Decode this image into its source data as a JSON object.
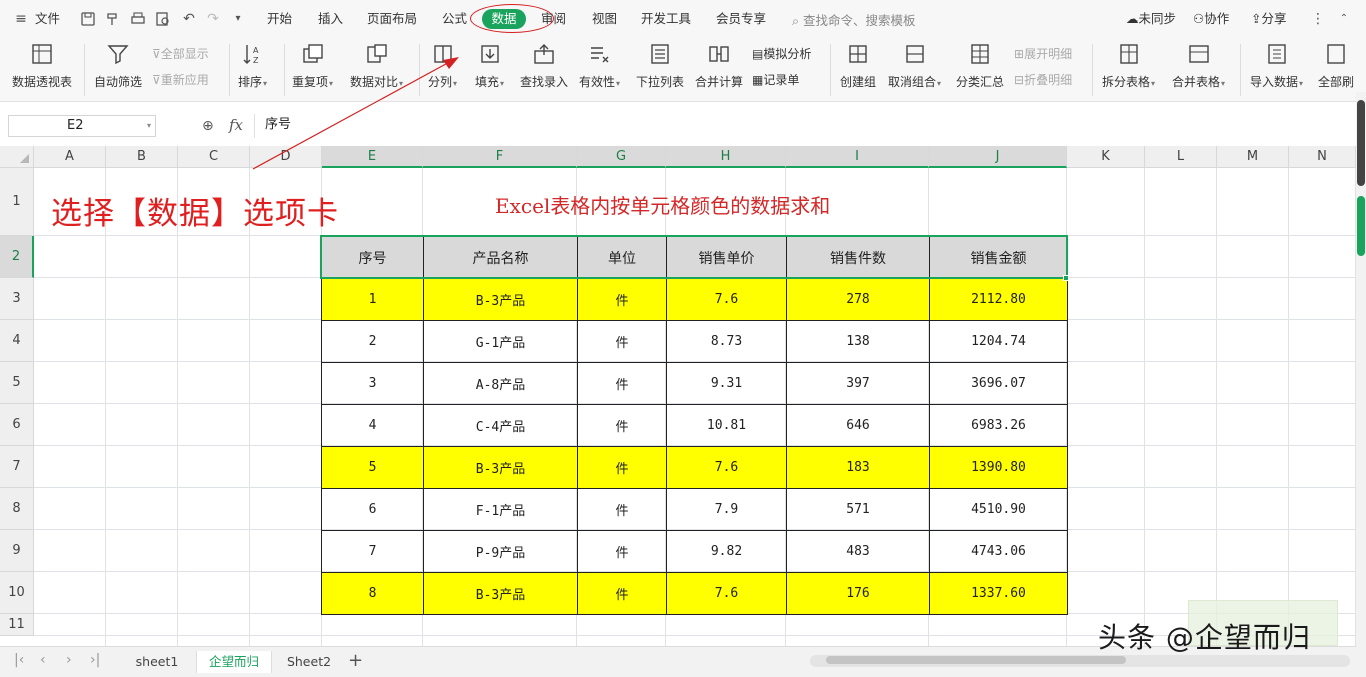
{
  "menu": {
    "file": "文件",
    "tabs": [
      "开始",
      "插入",
      "页面布局",
      "公式",
      "数据",
      "审阅",
      "视图",
      "开发工具",
      "会员专享"
    ],
    "active_tab": "数据",
    "search_placeholder": "查找命令、搜索模板",
    "sync": "未同步",
    "collaborate": "协作",
    "share": "分享"
  },
  "ribbon": {
    "pivot": "数据透视表",
    "autofilter": "自动筛选",
    "show_all": "全部显示",
    "reapply": "重新应用",
    "sort": "排序",
    "duplicates": "重复项",
    "compare": "数据对比",
    "split": "分列",
    "fill": "填充",
    "find_entry": "查找录入",
    "validity": "有效性",
    "dropdown": "下拉列表",
    "consolidate": "合并计算",
    "simulate": "模拟分析",
    "record": "记录单",
    "group": "创建组",
    "ungroup": "取消组合",
    "subtotal": "分类汇总",
    "expand": "展开明细",
    "collapse": "折叠明细",
    "split_table": "拆分表格",
    "merge_table": "合并表格",
    "import": "导入数据",
    "all": "全部刷"
  },
  "formula_bar": {
    "cell_ref": "E2",
    "fx": "fx",
    "content": "序号"
  },
  "columns": [
    "A",
    "B",
    "C",
    "D",
    "E",
    "F",
    "G",
    "H",
    "I",
    "J",
    "K",
    "L",
    "M",
    "N"
  ],
  "rows": [
    "1",
    "2",
    "3",
    "4",
    "5",
    "6",
    "7",
    "8",
    "9",
    "10",
    "11"
  ],
  "annotation": "选择【数据】选项卡",
  "sheet_title": "Excel表格内按单元格颜色的数据求和",
  "table": {
    "headers": [
      "序号",
      "产品名称",
      "单位",
      "销售单价",
      "销售件数",
      "销售金额"
    ],
    "rows": [
      [
        "1",
        "B-3产品",
        "件",
        "7.6",
        "278",
        "2112.80"
      ],
      [
        "2",
        "G-1产品",
        "件",
        "8.73",
        "138",
        "1204.74"
      ],
      [
        "3",
        "A-8产品",
        "件",
        "9.31",
        "397",
        "3696.07"
      ],
      [
        "4",
        "C-4产品",
        "件",
        "10.81",
        "646",
        "6983.26"
      ],
      [
        "5",
        "B-3产品",
        "件",
        "7.6",
        "183",
        "1390.80"
      ],
      [
        "6",
        "F-1产品",
        "件",
        "7.9",
        "571",
        "4510.90"
      ],
      [
        "7",
        "P-9产品",
        "件",
        "9.82",
        "483",
        "4743.06"
      ],
      [
        "8",
        "B-3产品",
        "件",
        "7.6",
        "176",
        "1337.60"
      ]
    ],
    "highlight_color": "#ffff00",
    "highlighted_rows": [
      0,
      4,
      7
    ]
  },
  "sheets": [
    "sheet1",
    "企望而归",
    "Sheet2"
  ],
  "active_sheet": "企望而归",
  "watermark": "头条 @企望而归",
  "colors": {
    "accent": "#1aa35d",
    "annotation_red": "#e02020"
  }
}
